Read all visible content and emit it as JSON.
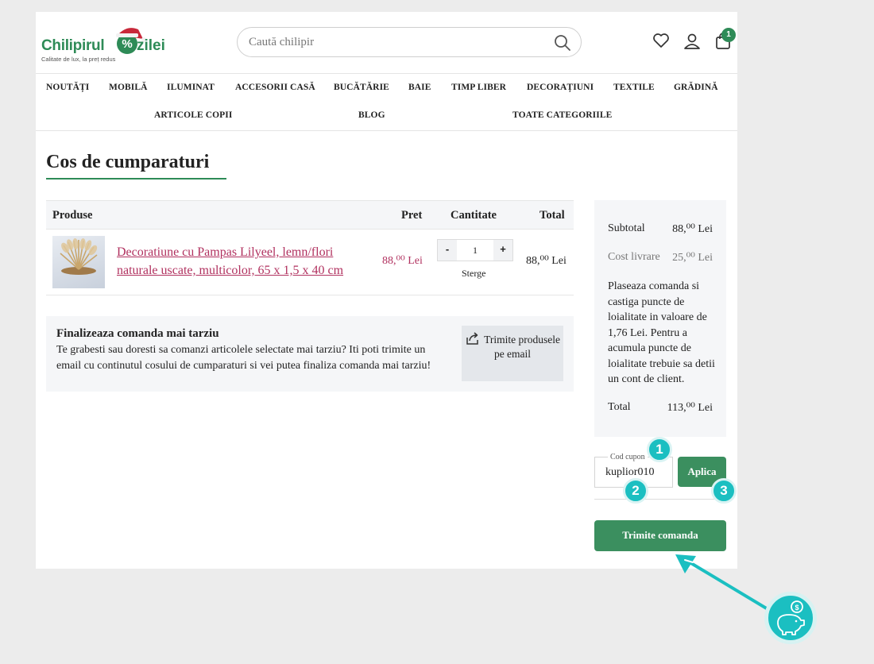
{
  "header": {
    "logo_word1": "Chilipirul",
    "logo_word2": "zilei",
    "logo_tagline": "Calitate de lux, la preț redus",
    "search_placeholder": "Caută chilipir",
    "cart_count": "1",
    "icons": [
      "heart-icon",
      "user-icon",
      "bag-icon",
      "search-icon"
    ]
  },
  "nav": {
    "items": [
      "NOUTĂȚI",
      "MOBILĂ",
      "ILUMINAT",
      "ACCESORII CASĂ",
      "BUCĂTĂRIE",
      "BAIE",
      "TIMP LIBER",
      "DECORAȚIUNI",
      "TEXTILE",
      "GRĂDINĂ",
      "ARTICOLE COPII",
      "BLOG",
      "TOATE CATEGORIILE"
    ]
  },
  "page": {
    "title": "Cos de cumparaturi"
  },
  "cart_table": {
    "columns": [
      "Produse",
      "Pret",
      "Cantitate",
      "Total"
    ],
    "rows": [
      {
        "name": "Decoratiune cu Pampas Lilyeel, lemn/flori naturale uscate, multicolor, 65 x 1,5 x 40 cm",
        "price": "88,⁰⁰ Lei",
        "qty": "1",
        "minus": "-",
        "plus": "+",
        "remove": "Sterge",
        "total": "88,⁰⁰ Lei"
      }
    ]
  },
  "later": {
    "title": "Finalizeaza comanda mai tarziu",
    "text": "Te grabesti sau doresti sa comanzi articolele selectate mai tarziu? Iti poti trimite un email cu continutul cosului de cumparaturi si vei putea finaliza comanda mai tarziu!",
    "button": "Trimite produsele pe email"
  },
  "summary": {
    "subtotal_label": "Subtotal",
    "subtotal_value": "88,⁰⁰ Lei",
    "shipping_label": "Cost livrare",
    "shipping_value": "25,⁰⁰ Lei",
    "note": "Plaseaza comanda si castiga puncte de loialitate in valoare de 1,76 Lei. Pentru a acumula puncte de loialitate trebuie sa detii un cont de client.",
    "total_label": "Total",
    "total_value": "113,⁰⁰ Lei"
  },
  "coupon": {
    "label": "Cod cupon",
    "value": "kuplior010",
    "apply": "Aplica"
  },
  "submit_label": "Trimite comanda",
  "callouts": [
    "1",
    "2",
    "3"
  ],
  "colors": {
    "brand_green": "#2e8b57",
    "button_green": "#3b8f5f",
    "link_pink": "#b1315f",
    "callout_teal": "#1bbfc1"
  }
}
